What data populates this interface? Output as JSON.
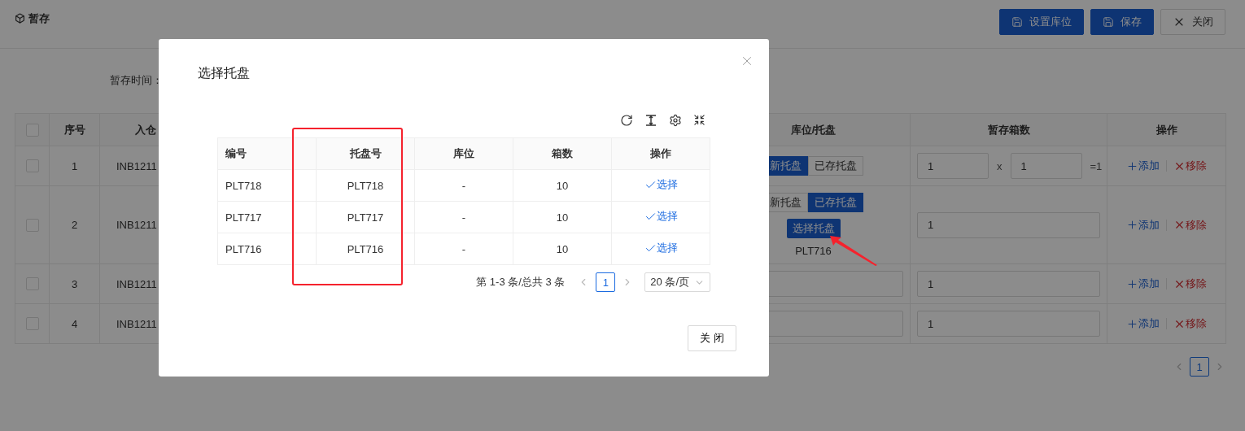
{
  "page": {
    "title": "暂存",
    "buttons": [
      {
        "label": "设置库位",
        "kind": "primary"
      },
      {
        "label": "保存",
        "kind": "primary"
      },
      {
        "label": "关闭",
        "kind": "default"
      }
    ],
    "form_label": "暂存时间："
  },
  "table": {
    "header_checked": false,
    "columns": [
      "序号",
      "入仓",
      "库位/托盘",
      "暂存箱数",
      "操作"
    ],
    "rows": [
      {
        "checked": false,
        "index": "1",
        "inbound": "INB1211",
        "location": {
          "kind": "toggle",
          "options": [
            {
              "label": "新托盘",
              "selected": true
            },
            {
              "label": "已存托盘",
              "selected": false
            }
          ]
        },
        "boxes": {
          "kind": "product",
          "values": [
            "1",
            "1"
          ],
          "operator": "x",
          "result": "=1"
        },
        "actions": [
          {
            "label": "添加",
            "kind": "add"
          },
          {
            "label": "移除",
            "kind": "remove"
          }
        ]
      },
      {
        "checked": false,
        "index": "2",
        "inbound": "INB1211",
        "location": {
          "kind": "toggle",
          "options": [
            {
              "label": "新托盘",
              "selected": false
            },
            {
              "label": "已存托盘",
              "selected": true
            }
          ],
          "pick_button": "选择托盘",
          "pallet": "PLT716"
        },
        "boxes": {
          "kind": "single",
          "values": [
            "1"
          ]
        },
        "actions": [
          {
            "label": "添加",
            "kind": "add"
          },
          {
            "label": "移除",
            "kind": "remove"
          }
        ]
      },
      {
        "checked": false,
        "index": "3",
        "inbound": "INB1211",
        "location": {
          "kind": "input"
        },
        "boxes": {
          "kind": "single",
          "values": [
            "1"
          ]
        },
        "actions": [
          {
            "label": "添加",
            "kind": "add"
          },
          {
            "label": "移除",
            "kind": "remove"
          }
        ]
      },
      {
        "checked": false,
        "index": "4",
        "inbound": "INB1211",
        "location": {
          "kind": "input"
        },
        "boxes": {
          "kind": "single",
          "values": [
            "1"
          ]
        },
        "actions": [
          {
            "label": "添加",
            "kind": "add"
          },
          {
            "label": "移除",
            "kind": "remove"
          }
        ]
      }
    ]
  },
  "pagination": {
    "pages": [
      {
        "label": "1",
        "selected": true
      }
    ]
  },
  "dialog": {
    "title": "选择托盘",
    "columns": [
      "编号",
      "托盘号",
      "库位",
      "箱数",
      "操作"
    ],
    "rows": [
      {
        "cells": [
          "PLT718",
          "PLT718",
          "-",
          "10"
        ],
        "action": "选择"
      },
      {
        "cells": [
          "PLT717",
          "PLT717",
          "-",
          "10"
        ],
        "action": "选择"
      },
      {
        "cells": [
          "PLT716",
          "PLT716",
          "-",
          "10"
        ],
        "action": "选择"
      }
    ],
    "pagination": {
      "summary": "第 1-3 条/总共 3 条",
      "pages": [
        {
          "label": "1",
          "selected": true
        }
      ],
      "page_size": "20 条/页"
    },
    "close_button": "关 闭"
  }
}
